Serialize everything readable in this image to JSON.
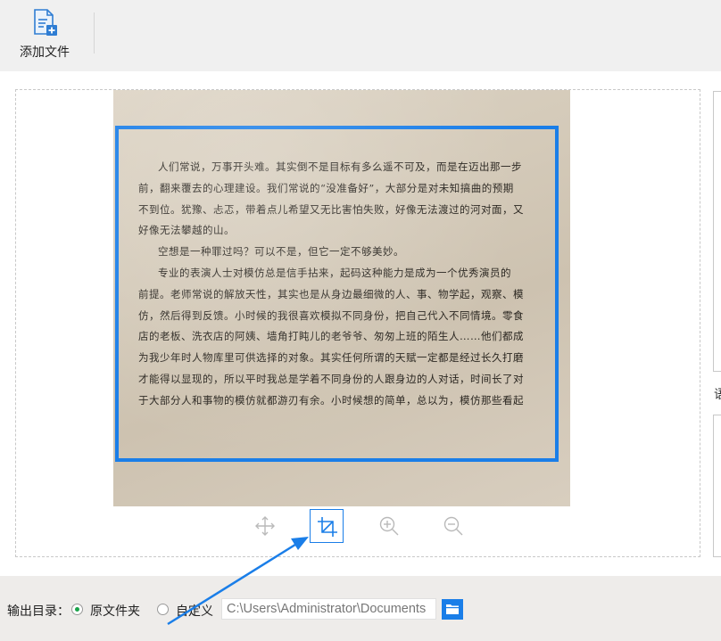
{
  "toolbar": {
    "add_file_label": "添加文件"
  },
  "document_text": {
    "lines": [
      "人们常说，万事开头难。其实倒不是目标有多么遥不可及，而是在迈出那一步",
      "前，翻来覆去的心理建设。我们常说的“没准备好”，大部分是对未知搞曲的预期",
      "不到位。犹豫、忐忑，带着点儿希望又无比害怕失败，好像无法渡过的河对面，又",
      "好像无法攀越的山。",
      "空想是一种罪过吗？可以不是，但它一定不够美妙。",
      "专业的表演人士对模仿总是信手拈来，起码这种能力是成为一个优秀演员的",
      "前提。老师常说的解放天性，其实也是从身边最细微的人、事、物学起，观察、模",
      "仿，然后得到反馈。小时候的我很喜欢模拟不同身份，把自己代入不同情境。零食",
      "店的老板、洗衣店的阿姨、墙角打盹儿的老爷爷、匆匆上班的陌生人……他们都成",
      "为我少年时人物库里可供选择的对象。其实任何所谓的天赋一定都是经过长久打磨",
      "才能得以显现的，所以平时我总是学着不同身份的人跟身边的人对话，时间长了对",
      "于大部分人和事物的模仿就都游刃有余。小时候想的简单，总以为，模仿那些看起"
    ]
  },
  "side_panel": {
    "partial_char": "语"
  },
  "footer": {
    "output_dir_label": "输出目录：",
    "option_source": "原文件夹",
    "option_custom": "自定义",
    "path_value": "C:\\Users\\Administrator\\Documents",
    "selected": "source"
  },
  "colors": {
    "accent": "#1a7ee8",
    "radio_checked": "#1aa34a"
  },
  "icons": {
    "add_file": "add-file-icon",
    "move": "move-icon",
    "crop": "crop-icon",
    "zoom_in": "zoom-in-icon",
    "zoom_out": "zoom-out-icon",
    "folder": "folder-icon"
  }
}
